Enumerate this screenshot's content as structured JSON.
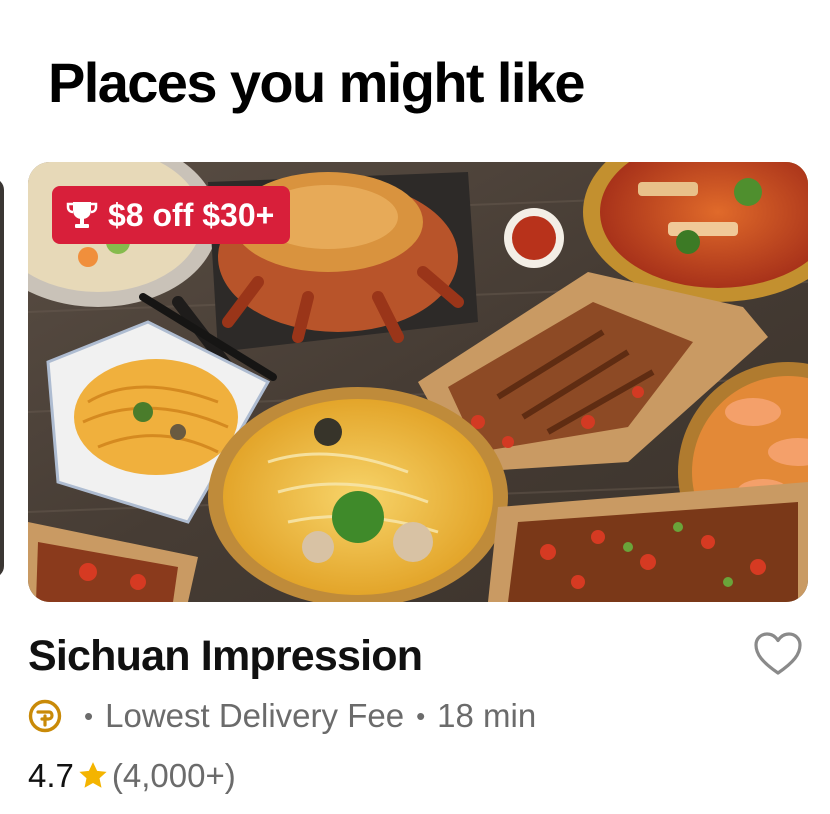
{
  "section": {
    "title": "Places you might like"
  },
  "store": {
    "name": "Sichuan Impression",
    "promo": "$8 off $30+",
    "promo_icon": "trophy-icon",
    "favorite_icon": "heart-outline-icon",
    "membership_icon": "dashpass-icon",
    "tagline": "Lowest Delivery Fee",
    "separator": "•",
    "delivery_time": "18 min",
    "rating": "4.7",
    "rating_icon": "star-icon",
    "rating_count": "(4,000+)"
  },
  "colors": {
    "promo_badge": "#d81f3a",
    "rating_star": "#f4b400",
    "membership_icon": "#c98a08",
    "muted_text": "#6b6b6b",
    "title_text": "#000000",
    "table_wood": "#4a4038"
  }
}
